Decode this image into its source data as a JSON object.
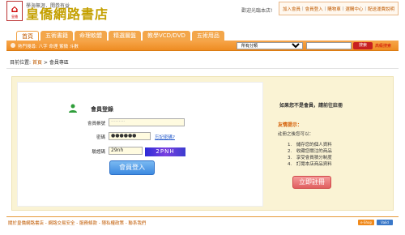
{
  "header": {
    "slogan": "學海無涯．開券有益",
    "brand": "皇僑網路書店",
    "logo_text": "皇僑",
    "welcome": "歡迎光臨本店!",
    "links": [
      "加入會員",
      "會員登入",
      "購物車",
      "選購中心",
      "配送運費說明"
    ]
  },
  "nav": {
    "tabs": [
      "首頁",
      "五術書籍",
      "命理軟體",
      "精選層盤",
      "教學VCD/DVD",
      "五術用品"
    ],
    "hot_search": "熱門搜尋: 八字 命理 紫微 斗數",
    "category_select": "所有分類",
    "search_button": "搜索",
    "advanced_search": "高級搜索"
  },
  "breadcrumb": {
    "prefix": "目前位置:",
    "home": "首頁",
    "separator": ">",
    "current": "會員專區"
  },
  "login": {
    "title": "會員登錄",
    "account_label": "會員帳號",
    "account_value": "·········",
    "password_label": "密碼",
    "password_value": "●●●●●●",
    "forgot_link": "忘記密碼?",
    "captcha_label": "驗證碼",
    "captcha_input": "29nh",
    "captcha_image_text": "2PNH",
    "submit": "會員登入"
  },
  "side": {
    "heading": "如果您不是會員，請前往註冊",
    "tips_title": "友情提示：",
    "tips_intro": "註冊之後您可以：",
    "tips": [
      "1.　儲存您的個人資料",
      "2.　收藏您關注的商品",
      "3.　享受會員積分制度",
      "4.　訂閱本店商品資料"
    ],
    "register_button": "立即註冊"
  },
  "footer": {
    "text": "關於皇僑網路書店 - 網路交易安全 - 服務條款 - 隱私權政策 - 聯系我們",
    "badges": [
      {
        "label": "e-Shop",
        "color": "#f08a1c"
      },
      {
        "label": "Valid",
        "color": "#3a78c8"
      }
    ]
  }
}
